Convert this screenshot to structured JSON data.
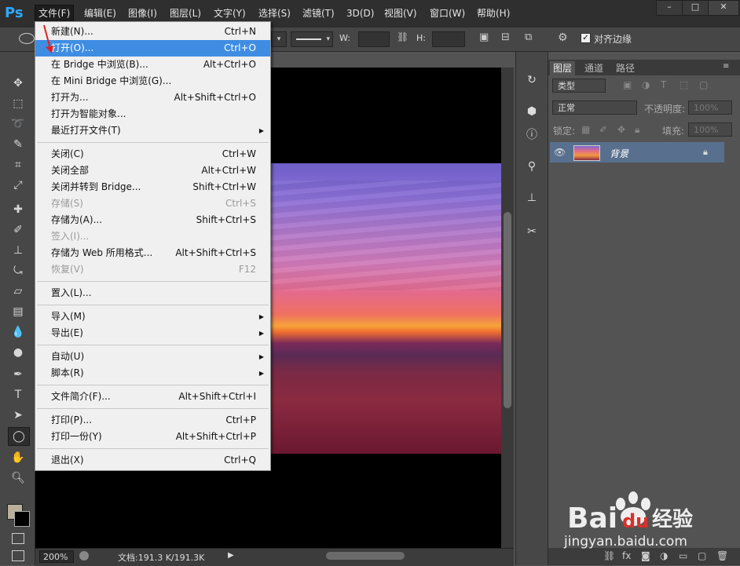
{
  "app": {
    "logo": "Ps"
  },
  "menubar": {
    "items": [
      "文件(F)",
      "编辑(E)",
      "图像(I)",
      "图层(L)",
      "文字(Y)",
      "选择(S)",
      "滤镜(T)",
      "3D(D)",
      "视图(V)",
      "窗口(W)",
      "帮助(H)"
    ],
    "active_index": 0
  },
  "window_controls": [
    "–",
    "□",
    "✕"
  ],
  "options_bar": {
    "w_label": "W:",
    "h_label": "H:",
    "align_edges_label": "对齐边缘",
    "align_edges_checked": true
  },
  "file_menu": {
    "items": [
      {
        "label": "新建(N)...",
        "shortcut": "Ctrl+N",
        "disabled": false,
        "submenu": false,
        "highlight": false
      },
      {
        "label": "打开(O)...",
        "shortcut": "Ctrl+O",
        "disabled": false,
        "submenu": false,
        "highlight": true
      },
      {
        "label": "在 Bridge 中浏览(B)...",
        "shortcut": "Alt+Ctrl+O",
        "disabled": false,
        "submenu": false,
        "highlight": false
      },
      {
        "label": "在 Mini Bridge 中浏览(G)...",
        "shortcut": "",
        "disabled": false,
        "submenu": false,
        "highlight": false
      },
      {
        "label": "打开为...",
        "shortcut": "Alt+Shift+Ctrl+O",
        "disabled": false,
        "submenu": false,
        "highlight": false
      },
      {
        "label": "打开为智能对象...",
        "shortcut": "",
        "disabled": false,
        "submenu": false,
        "highlight": false
      },
      {
        "label": "最近打开文件(T)",
        "shortcut": "",
        "disabled": false,
        "submenu": true,
        "highlight": false
      },
      {
        "sep": true
      },
      {
        "label": "关闭(C)",
        "shortcut": "Ctrl+W",
        "disabled": false,
        "submenu": false,
        "highlight": false
      },
      {
        "label": "关闭全部",
        "shortcut": "Alt+Ctrl+W",
        "disabled": false,
        "submenu": false,
        "highlight": false
      },
      {
        "label": "关闭并转到 Bridge...",
        "shortcut": "Shift+Ctrl+W",
        "disabled": false,
        "submenu": false,
        "highlight": false
      },
      {
        "label": "存储(S)",
        "shortcut": "Ctrl+S",
        "disabled": true,
        "submenu": false,
        "highlight": false
      },
      {
        "label": "存储为(A)...",
        "shortcut": "Shift+Ctrl+S",
        "disabled": false,
        "submenu": false,
        "highlight": false
      },
      {
        "label": "签入(I)...",
        "shortcut": "",
        "disabled": true,
        "submenu": false,
        "highlight": false
      },
      {
        "label": "存储为 Web 所用格式...",
        "shortcut": "Alt+Shift+Ctrl+S",
        "disabled": false,
        "submenu": false,
        "highlight": false
      },
      {
        "label": "恢复(V)",
        "shortcut": "F12",
        "disabled": true,
        "submenu": false,
        "highlight": false
      },
      {
        "sep": true
      },
      {
        "label": "置入(L)...",
        "shortcut": "",
        "disabled": false,
        "submenu": false,
        "highlight": false
      },
      {
        "sep": true
      },
      {
        "label": "导入(M)",
        "shortcut": "",
        "disabled": false,
        "submenu": true,
        "highlight": false
      },
      {
        "label": "导出(E)",
        "shortcut": "",
        "disabled": false,
        "submenu": true,
        "highlight": false
      },
      {
        "sep": true
      },
      {
        "label": "自动(U)",
        "shortcut": "",
        "disabled": false,
        "submenu": true,
        "highlight": false
      },
      {
        "label": "脚本(R)",
        "shortcut": "",
        "disabled": false,
        "submenu": true,
        "highlight": false
      },
      {
        "sep": true
      },
      {
        "label": "文件简介(F)...",
        "shortcut": "Alt+Shift+Ctrl+I",
        "disabled": false,
        "submenu": false,
        "highlight": false
      },
      {
        "sep": true
      },
      {
        "label": "打印(P)...",
        "shortcut": "Ctrl+P",
        "disabled": false,
        "submenu": false,
        "highlight": false
      },
      {
        "label": "打印一份(Y)",
        "shortcut": "Alt+Shift+Ctrl+P",
        "disabled": false,
        "submenu": false,
        "highlight": false
      },
      {
        "sep": true
      },
      {
        "label": "退出(X)",
        "shortcut": "Ctrl+Q",
        "disabled": false,
        "submenu": false,
        "highlight": false
      }
    ]
  },
  "status": {
    "zoom": "200%",
    "doc_info": "文档:191.3 K/191.3K"
  },
  "layers_panel": {
    "tabs": [
      "图层",
      "通道",
      "路径"
    ],
    "active_tab": 0,
    "kind_label": "类型",
    "blend_mode": "正常",
    "opacity_label": "不透明度:",
    "opacity_value": "100%",
    "lock_label": "锁定:",
    "fill_label": "填充:",
    "fill_value": "100%",
    "layer_name": "背景"
  },
  "watermark": {
    "brand": "Bai",
    "brand2": "du",
    "suffix": "经验",
    "url": "jingyan.baidu.com"
  },
  "colors": {
    "highlight": "#3f8de3",
    "accent_logo": "#30a8ff"
  }
}
